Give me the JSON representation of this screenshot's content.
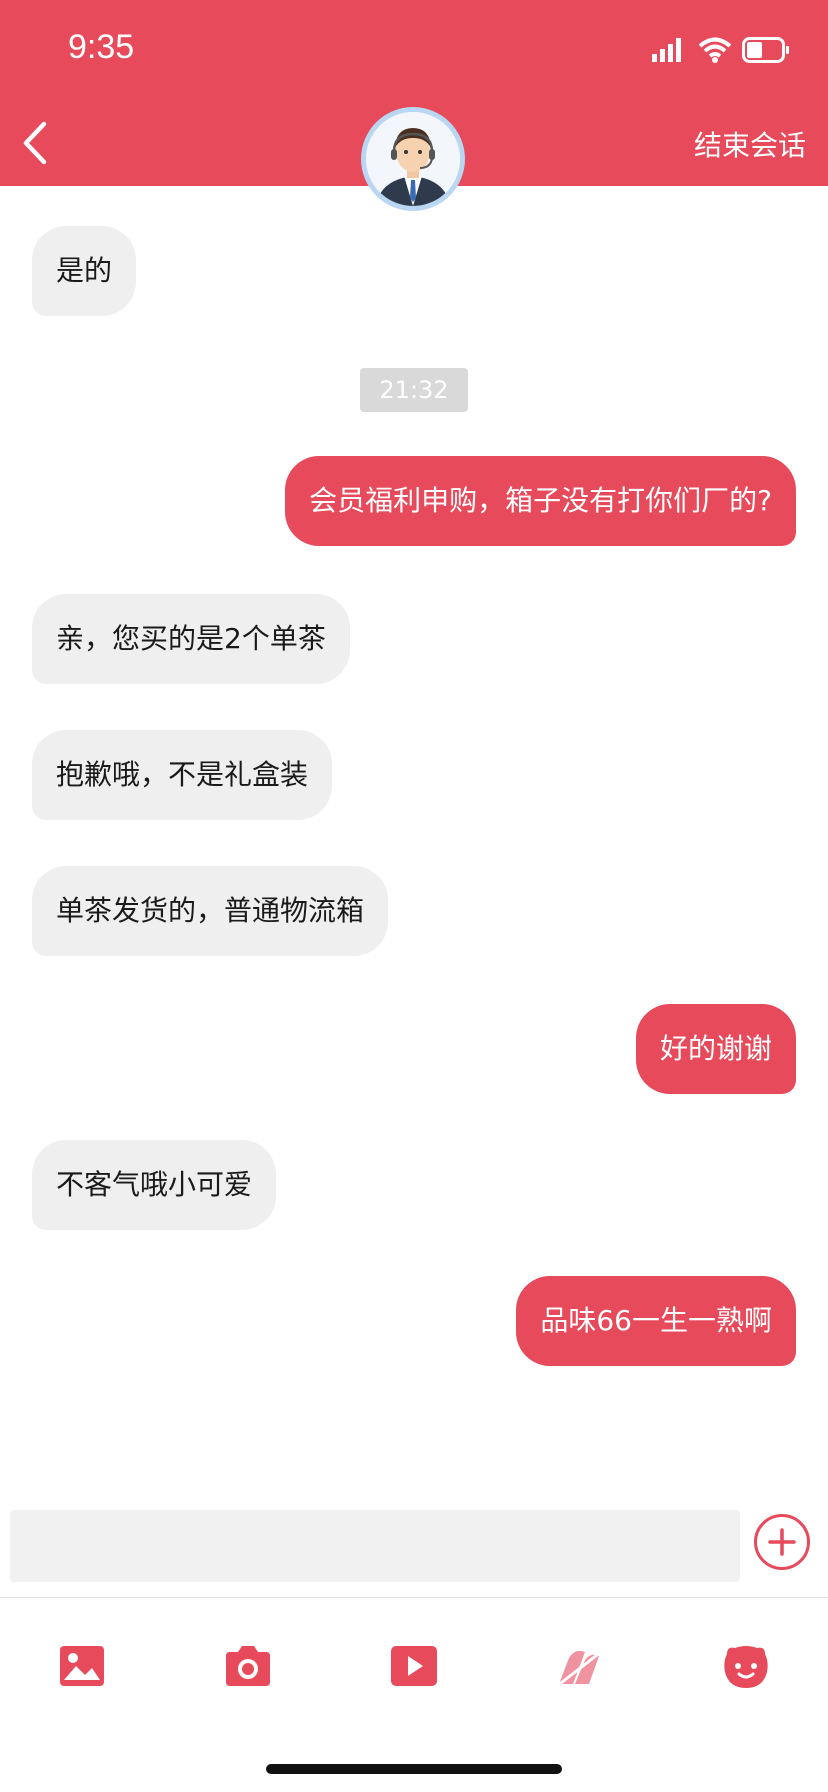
{
  "status_bar": {
    "time": "9:35"
  },
  "header": {
    "end_session_label": "结束会话"
  },
  "colors": {
    "accent": "#e64a5b",
    "incoming_bubble": "#efefef",
    "timestamp_bg": "#d9d9d9"
  },
  "messages": [
    {
      "from": "agent",
      "text": "是的"
    },
    {
      "type": "timestamp",
      "text": "21:32"
    },
    {
      "from": "user",
      "text": "会员福利申购，箱子没有打你们厂的?"
    },
    {
      "from": "agent",
      "text": "亲，您买的是2个单茶"
    },
    {
      "from": "agent",
      "text": "抱歉哦，不是礼盒装"
    },
    {
      "from": "agent",
      "text": "单茶发货的，普通物流箱"
    },
    {
      "from": "user",
      "text": "好的谢谢"
    },
    {
      "from": "agent",
      "text": "不客气哦小可爱"
    },
    {
      "from": "user",
      "text": "品味66一生一熟啊"
    }
  ],
  "input": {
    "value": "",
    "placeholder": ""
  },
  "toolbar": [
    "image-icon",
    "camera-icon",
    "video-icon",
    "tea-icon",
    "emoji-icon"
  ]
}
